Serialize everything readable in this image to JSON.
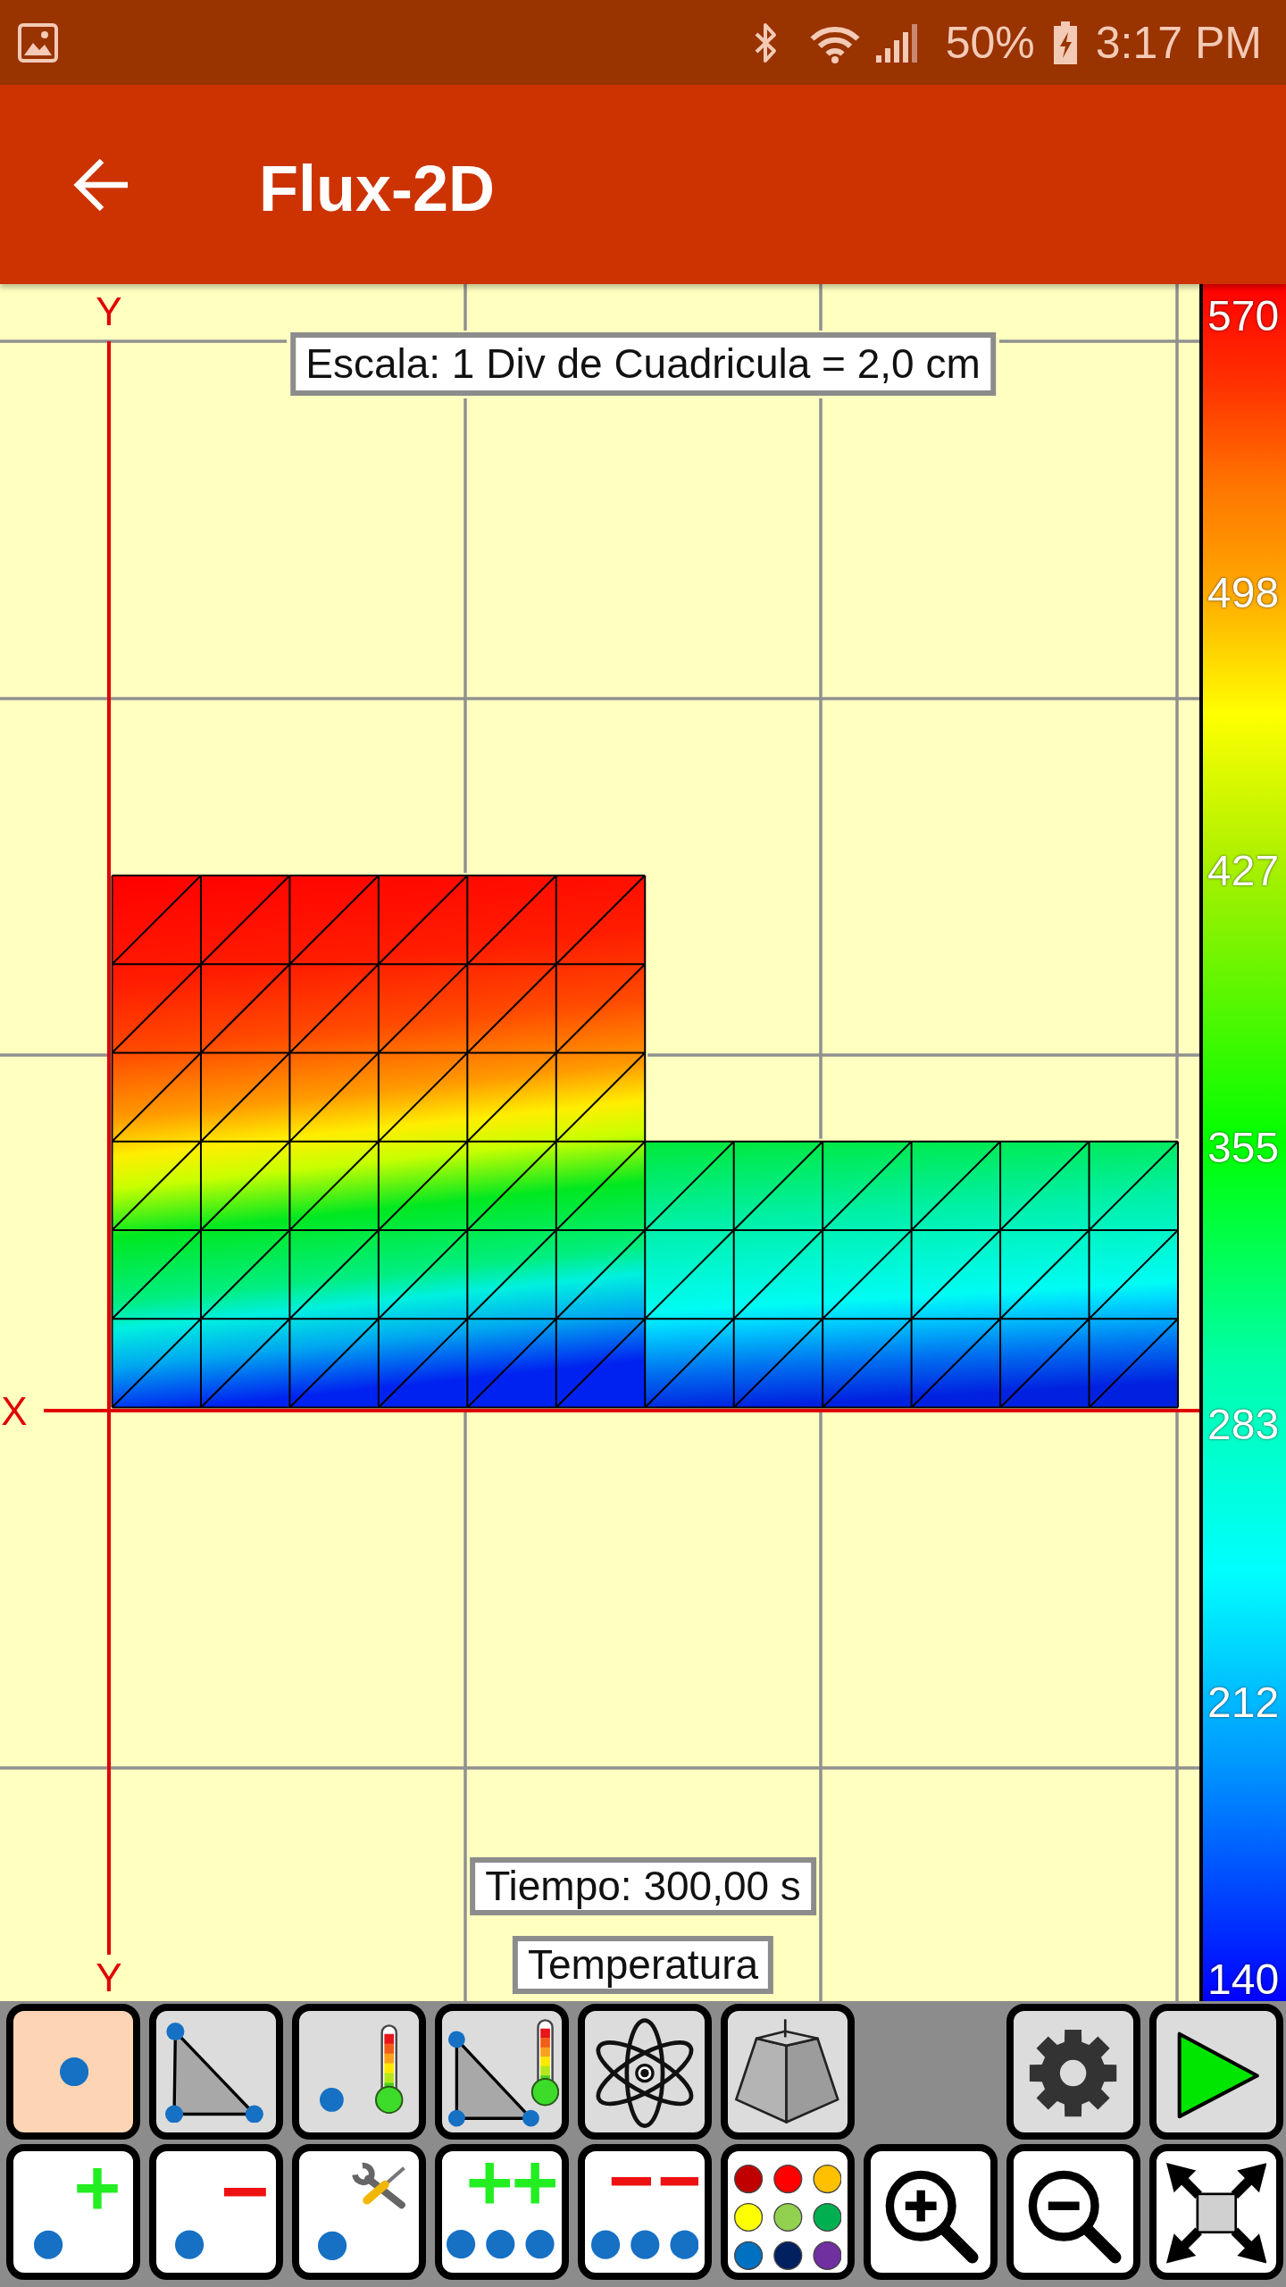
{
  "status_bar": {
    "battery": "50%",
    "time": "3:17 PM"
  },
  "app_bar": {
    "title": "Flux-2D"
  },
  "canvas": {
    "axis_labels": {
      "y_top": "Y",
      "x": "X",
      "y_bottom": "Y"
    },
    "scale_label": "Escala: 1 Div de Cuadricula = 2,0 cm",
    "time_label": "Tiempo: 300,00 s",
    "quantity_label": "Temperatura"
  },
  "color_scale": {
    "labels": [
      "570",
      "498",
      "427",
      "355",
      "283",
      "212",
      "140"
    ]
  },
  "toolbar": {
    "modes": [
      {
        "kind": "node",
        "selected": true
      },
      {
        "kind": "element",
        "selected": false
      },
      {
        "kind": "node-temperature",
        "selected": false
      },
      {
        "kind": "element-temperature",
        "selected": false
      },
      {
        "kind": "atom",
        "selected": false
      },
      {
        "kind": "frustum",
        "selected": false
      }
    ],
    "actions": [
      {
        "kind": "settings"
      },
      {
        "kind": "play"
      }
    ],
    "edit_tools": [
      {
        "kind": "add-node"
      },
      {
        "kind": "remove-node"
      },
      {
        "kind": "edit-node"
      },
      {
        "kind": "add-nodes"
      },
      {
        "kind": "remove-nodes"
      },
      {
        "kind": "palette"
      },
      {
        "kind": "zoom-in"
      },
      {
        "kind": "zoom-out"
      },
      {
        "kind": "fit"
      }
    ]
  }
}
